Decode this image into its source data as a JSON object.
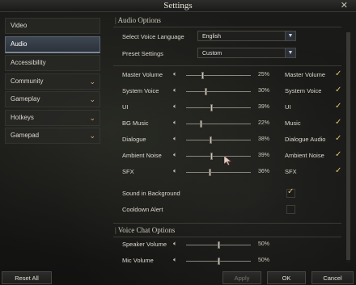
{
  "window": {
    "title": "Settings",
    "close_glyph": "✕"
  },
  "sidebar": {
    "items": [
      {
        "label": "Video",
        "has_chevron": false
      },
      {
        "label": "Audio",
        "has_chevron": false,
        "active": true
      },
      {
        "label": "Accessibility",
        "has_chevron": false
      },
      {
        "label": "Community",
        "has_chevron": true
      },
      {
        "label": "Gameplay",
        "has_chevron": true
      },
      {
        "label": "Hotkeys",
        "has_chevron": true
      },
      {
        "label": "Gamepad",
        "has_chevron": true
      }
    ]
  },
  "audio": {
    "section_title": "Audio Options",
    "voice_language": {
      "label": "Select Voice Language",
      "value": "English"
    },
    "preset": {
      "label": "Preset Settings",
      "value": "Custom"
    },
    "sliders": [
      {
        "label": "Master Volume",
        "percent": 25,
        "value_text": "25%",
        "sub_label": "Master Volume",
        "checked": true
      },
      {
        "label": "System Voice",
        "percent": 30,
        "value_text": "30%",
        "sub_label": "System Voice",
        "checked": true
      },
      {
        "label": "UI",
        "percent": 39,
        "value_text": "39%",
        "sub_label": "UI",
        "checked": true
      },
      {
        "label": "BG Music",
        "percent": 22,
        "value_text": "22%",
        "sub_label": "Music",
        "checked": true
      },
      {
        "label": "Dialogue",
        "percent": 38,
        "value_text": "38%",
        "sub_label": "Dialogue Audio",
        "checked": true
      },
      {
        "label": "Ambient Noise",
        "percent": 39,
        "value_text": "39%",
        "sub_label": "Ambient Noise",
        "checked": true
      },
      {
        "label": "SFX",
        "percent": 36,
        "value_text": "36%",
        "sub_label": "SFX",
        "checked": true
      }
    ],
    "toggles": [
      {
        "label": "Sound in Background",
        "checked": true
      },
      {
        "label": "Cooldown Alert",
        "checked": false
      }
    ]
  },
  "voice_chat": {
    "section_title": "Voice Chat Options",
    "sliders": [
      {
        "label": "Speaker Volume",
        "percent": 50,
        "value_text": "50%"
      },
      {
        "label": "Mic Volume",
        "percent": 50,
        "value_text": "50%"
      }
    ]
  },
  "footer": {
    "reset_label": "Reset All",
    "apply_label": "Apply",
    "ok_label": "OK",
    "cancel_label": "Cancel"
  },
  "icons": {
    "speaker": "speaker-icon",
    "check": "checkmark-icon",
    "chevron": "chevron-down-icon"
  },
  "colors": {
    "accent_gold": "#e1c372",
    "active_tab": "#3e4651"
  }
}
